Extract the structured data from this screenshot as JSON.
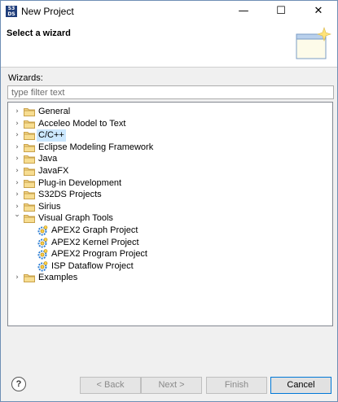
{
  "window": {
    "title": "New Project",
    "icon_text": "S3 DS"
  },
  "controls": {
    "minimize": "—",
    "maximize": "☐",
    "close": "✕"
  },
  "banner": {
    "title": "Select a wizard"
  },
  "wizards_label": "Wizards:",
  "filter": {
    "placeholder": "type filter text",
    "value": ""
  },
  "tree": [
    {
      "label": "General",
      "expanded": false,
      "type": "folder"
    },
    {
      "label": "Acceleo Model to Text",
      "expanded": false,
      "type": "folder"
    },
    {
      "label": "C/C++",
      "expanded": false,
      "type": "folder",
      "selected": true
    },
    {
      "label": "Eclipse Modeling Framework",
      "expanded": false,
      "type": "folder"
    },
    {
      "label": "Java",
      "expanded": false,
      "type": "folder"
    },
    {
      "label": "JavaFX",
      "expanded": false,
      "type": "folder"
    },
    {
      "label": "Plug-in Development",
      "expanded": false,
      "type": "folder"
    },
    {
      "label": "S32DS Projects",
      "expanded": false,
      "type": "folder"
    },
    {
      "label": "Sirius",
      "expanded": false,
      "type": "folder"
    },
    {
      "label": "Visual Graph Tools",
      "expanded": true,
      "type": "folder",
      "children": [
        {
          "label": "APEX2 Graph Project",
          "icon": "gear-icon"
        },
        {
          "label": "APEX2 Kernel Project",
          "icon": "gear-icon"
        },
        {
          "label": "APEX2 Program Project",
          "icon": "gear-icon"
        },
        {
          "label": "ISP Dataflow Project",
          "icon": "gear-icon"
        }
      ]
    },
    {
      "label": "Examples",
      "expanded": false,
      "type": "folder"
    }
  ],
  "buttons": {
    "help": "?",
    "back": "< Back",
    "next": "Next >",
    "finish": "Finish",
    "cancel": "Cancel"
  },
  "colors": {
    "selection": "#cce8ff",
    "accent": "#0078d7",
    "folder": "#e8c36a"
  }
}
